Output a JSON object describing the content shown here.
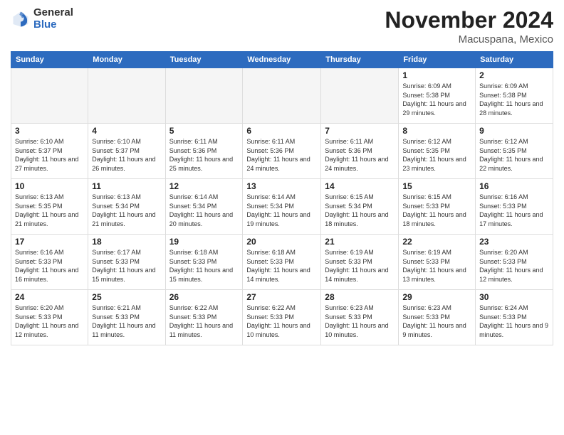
{
  "logo": {
    "general": "General",
    "blue": "Blue"
  },
  "header": {
    "month": "November 2024",
    "location": "Macuspana, Mexico"
  },
  "weekdays": [
    "Sunday",
    "Monday",
    "Tuesday",
    "Wednesday",
    "Thursday",
    "Friday",
    "Saturday"
  ],
  "weeks": [
    [
      {
        "day": "",
        "info": ""
      },
      {
        "day": "",
        "info": ""
      },
      {
        "day": "",
        "info": ""
      },
      {
        "day": "",
        "info": ""
      },
      {
        "day": "",
        "info": ""
      },
      {
        "day": "1",
        "info": "Sunrise: 6:09 AM\nSunset: 5:38 PM\nDaylight: 11 hours and 29 minutes."
      },
      {
        "day": "2",
        "info": "Sunrise: 6:09 AM\nSunset: 5:38 PM\nDaylight: 11 hours and 28 minutes."
      }
    ],
    [
      {
        "day": "3",
        "info": "Sunrise: 6:10 AM\nSunset: 5:37 PM\nDaylight: 11 hours and 27 minutes."
      },
      {
        "day": "4",
        "info": "Sunrise: 6:10 AM\nSunset: 5:37 PM\nDaylight: 11 hours and 26 minutes."
      },
      {
        "day": "5",
        "info": "Sunrise: 6:11 AM\nSunset: 5:36 PM\nDaylight: 11 hours and 25 minutes."
      },
      {
        "day": "6",
        "info": "Sunrise: 6:11 AM\nSunset: 5:36 PM\nDaylight: 11 hours and 24 minutes."
      },
      {
        "day": "7",
        "info": "Sunrise: 6:11 AM\nSunset: 5:36 PM\nDaylight: 11 hours and 24 minutes."
      },
      {
        "day": "8",
        "info": "Sunrise: 6:12 AM\nSunset: 5:35 PM\nDaylight: 11 hours and 23 minutes."
      },
      {
        "day": "9",
        "info": "Sunrise: 6:12 AM\nSunset: 5:35 PM\nDaylight: 11 hours and 22 minutes."
      }
    ],
    [
      {
        "day": "10",
        "info": "Sunrise: 6:13 AM\nSunset: 5:35 PM\nDaylight: 11 hours and 21 minutes."
      },
      {
        "day": "11",
        "info": "Sunrise: 6:13 AM\nSunset: 5:34 PM\nDaylight: 11 hours and 21 minutes."
      },
      {
        "day": "12",
        "info": "Sunrise: 6:14 AM\nSunset: 5:34 PM\nDaylight: 11 hours and 20 minutes."
      },
      {
        "day": "13",
        "info": "Sunrise: 6:14 AM\nSunset: 5:34 PM\nDaylight: 11 hours and 19 minutes."
      },
      {
        "day": "14",
        "info": "Sunrise: 6:15 AM\nSunset: 5:34 PM\nDaylight: 11 hours and 18 minutes."
      },
      {
        "day": "15",
        "info": "Sunrise: 6:15 AM\nSunset: 5:33 PM\nDaylight: 11 hours and 18 minutes."
      },
      {
        "day": "16",
        "info": "Sunrise: 6:16 AM\nSunset: 5:33 PM\nDaylight: 11 hours and 17 minutes."
      }
    ],
    [
      {
        "day": "17",
        "info": "Sunrise: 6:16 AM\nSunset: 5:33 PM\nDaylight: 11 hours and 16 minutes."
      },
      {
        "day": "18",
        "info": "Sunrise: 6:17 AM\nSunset: 5:33 PM\nDaylight: 11 hours and 15 minutes."
      },
      {
        "day": "19",
        "info": "Sunrise: 6:18 AM\nSunset: 5:33 PM\nDaylight: 11 hours and 15 minutes."
      },
      {
        "day": "20",
        "info": "Sunrise: 6:18 AM\nSunset: 5:33 PM\nDaylight: 11 hours and 14 minutes."
      },
      {
        "day": "21",
        "info": "Sunrise: 6:19 AM\nSunset: 5:33 PM\nDaylight: 11 hours and 14 minutes."
      },
      {
        "day": "22",
        "info": "Sunrise: 6:19 AM\nSunset: 5:33 PM\nDaylight: 11 hours and 13 minutes."
      },
      {
        "day": "23",
        "info": "Sunrise: 6:20 AM\nSunset: 5:33 PM\nDaylight: 11 hours and 12 minutes."
      }
    ],
    [
      {
        "day": "24",
        "info": "Sunrise: 6:20 AM\nSunset: 5:33 PM\nDaylight: 11 hours and 12 minutes."
      },
      {
        "day": "25",
        "info": "Sunrise: 6:21 AM\nSunset: 5:33 PM\nDaylight: 11 hours and 11 minutes."
      },
      {
        "day": "26",
        "info": "Sunrise: 6:22 AM\nSunset: 5:33 PM\nDaylight: 11 hours and 11 minutes."
      },
      {
        "day": "27",
        "info": "Sunrise: 6:22 AM\nSunset: 5:33 PM\nDaylight: 11 hours and 10 minutes."
      },
      {
        "day": "28",
        "info": "Sunrise: 6:23 AM\nSunset: 5:33 PM\nDaylight: 11 hours and 10 minutes."
      },
      {
        "day": "29",
        "info": "Sunrise: 6:23 AM\nSunset: 5:33 PM\nDaylight: 11 hours and 9 minutes."
      },
      {
        "day": "30",
        "info": "Sunrise: 6:24 AM\nSunset: 5:33 PM\nDaylight: 11 hours and 9 minutes."
      }
    ]
  ]
}
